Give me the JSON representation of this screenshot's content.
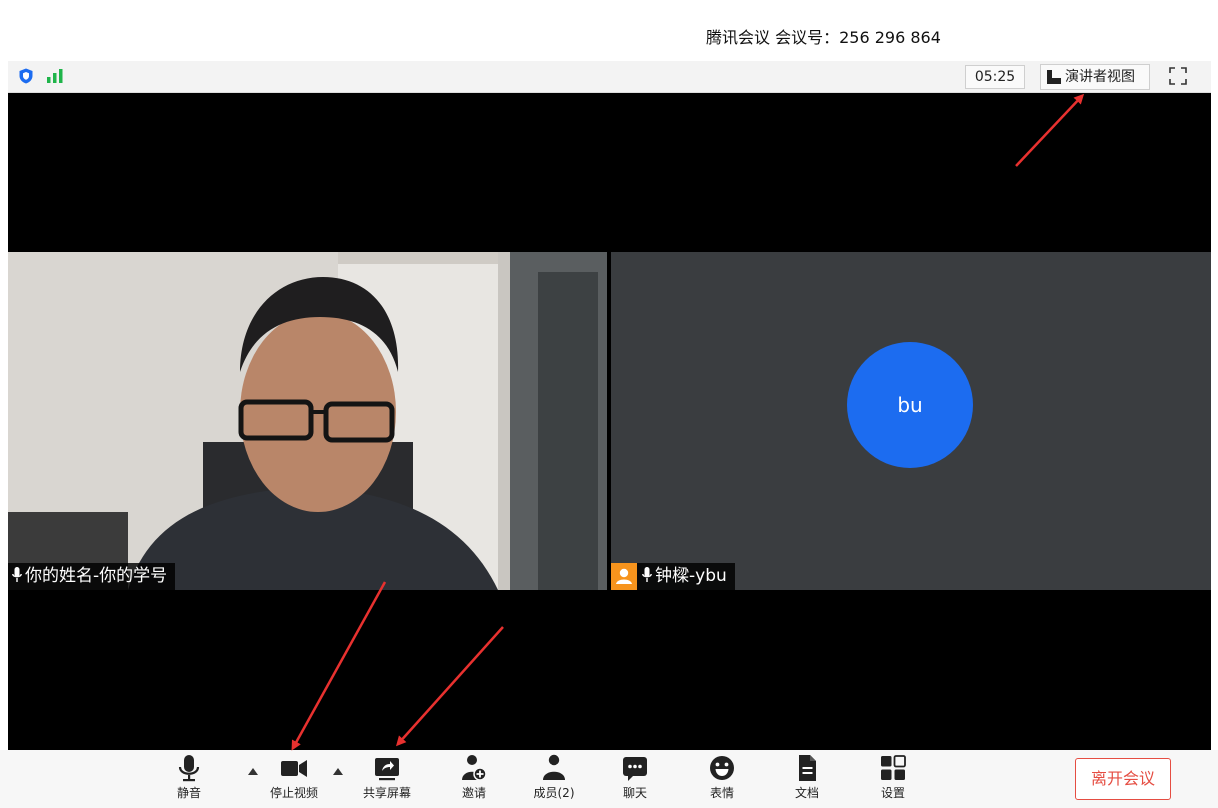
{
  "header": {
    "title": "腾讯会议 会议号：256 296 864"
  },
  "topbar": {
    "timer": "05:25",
    "speaker_view_label": "演讲者视图"
  },
  "videos": [
    {
      "name": "你的姓名-你的学号"
    },
    {
      "name": "钟樑-ybu",
      "avatar_text": "bu"
    }
  ],
  "toolbar": {
    "items": [
      {
        "label": "静音",
        "icon": "microphone-icon"
      },
      {
        "label": "停止视频",
        "icon": "video-camera-icon"
      },
      {
        "label": "共享屏幕",
        "icon": "share-screen-icon"
      },
      {
        "label": "邀请",
        "icon": "invite-user-icon"
      },
      {
        "label": "成员(2)",
        "icon": "members-icon"
      },
      {
        "label": "聊天",
        "icon": "chat-icon"
      },
      {
        "label": "表情",
        "icon": "emoji-icon"
      },
      {
        "label": "文档",
        "icon": "document-icon"
      },
      {
        "label": "设置",
        "icon": "settings-grid-icon"
      }
    ],
    "leave_label": "离开会议"
  },
  "colors": {
    "accent_blue": "#1c6cf0",
    "leave_red": "#e54d42",
    "arrow_red": "#e8312f",
    "user_badge_orange": "#f7941d",
    "signal_green": "#1fb44a"
  }
}
